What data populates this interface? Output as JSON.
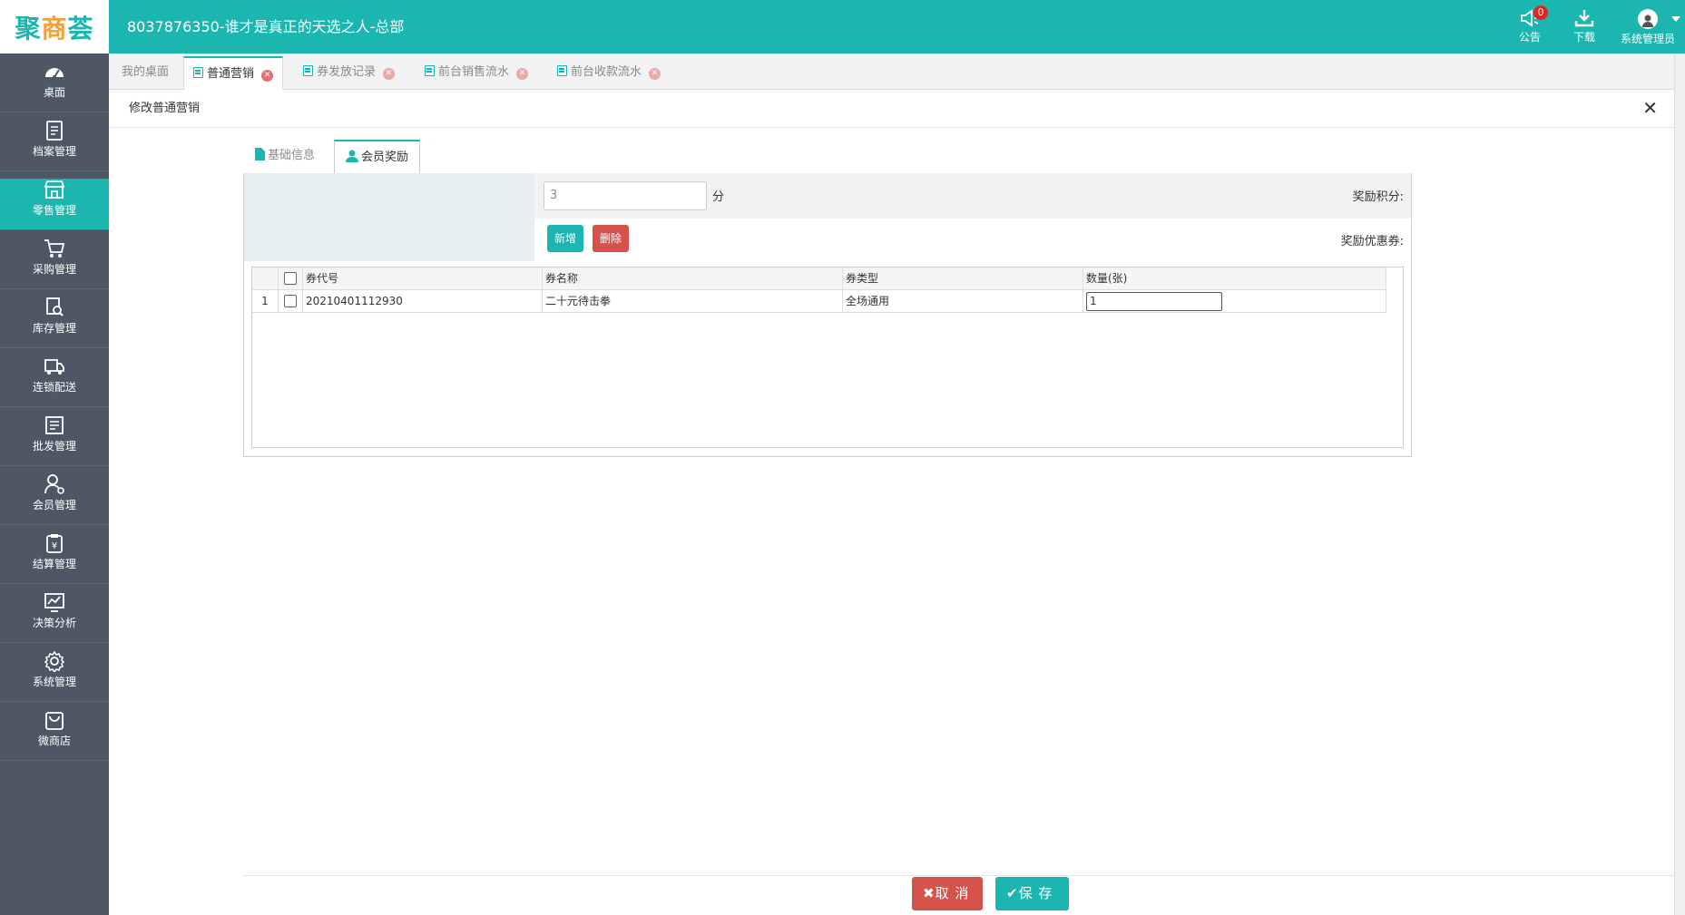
{
  "logo": {
    "part1": "聚",
    "part2": "商",
    "part3": "荟"
  },
  "header": {
    "title": "8037876350-谁才是真正的天选之人-总部",
    "notice_label": "公告",
    "notice_count": "0",
    "download_label": "下载",
    "user_label": "系统管理员"
  },
  "sidebar": {
    "items": [
      {
        "label": "桌面",
        "icon": "dashboard-icon"
      },
      {
        "label": "档案管理",
        "icon": "archive-icon"
      },
      {
        "label": "零售管理",
        "icon": "store-icon"
      },
      {
        "label": "采购管理",
        "icon": "cart-icon"
      },
      {
        "label": "库存管理",
        "icon": "inventory-icon"
      },
      {
        "label": "连锁配送",
        "icon": "truck-icon"
      },
      {
        "label": "批发管理",
        "icon": "wholesale-icon"
      },
      {
        "label": "会员管理",
        "icon": "member-icon"
      },
      {
        "label": "结算管理",
        "icon": "settlement-icon"
      },
      {
        "label": "决策分析",
        "icon": "chart-icon"
      },
      {
        "label": "系统管理",
        "icon": "gear-icon"
      },
      {
        "label": "微商店",
        "icon": "bag-icon"
      }
    ],
    "active_index": 2
  },
  "tabs": [
    {
      "label": "我的桌面"
    },
    {
      "label": "普通营销"
    },
    {
      "label": "券发放记录"
    },
    {
      "label": "前台销售流水"
    },
    {
      "label": "前台收款流水"
    }
  ],
  "page": {
    "title": "修改普通营销",
    "close": "✕"
  },
  "form_tabs": [
    {
      "label": "基础信息"
    },
    {
      "label": "会员奖励"
    }
  ],
  "form": {
    "points_label": "奖励积分:",
    "points_value": "3",
    "points_unit": "分",
    "coupon_label": "奖励优惠券:",
    "add_label": "新增",
    "delete_label": "删除"
  },
  "grid": {
    "columns": [
      "券代号",
      "券名称",
      "券类型",
      "数量(张)"
    ],
    "rows": [
      {
        "index": "1",
        "code": "20210401112930",
        "name": "二十元待击拳",
        "type": "全场通用",
        "qty": "1"
      }
    ]
  },
  "footer": {
    "cancel_label": "取 消",
    "save_label": "保 存"
  }
}
